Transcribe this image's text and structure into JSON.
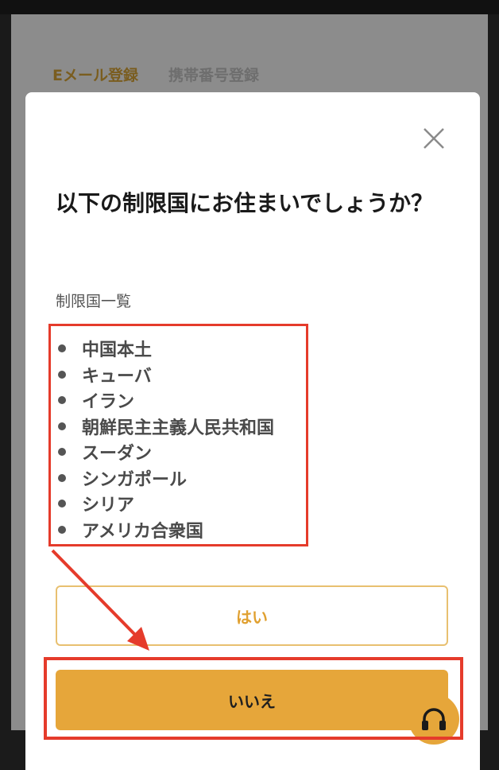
{
  "background": {
    "tabs": [
      {
        "label": "Eメール登録",
        "active": true
      },
      {
        "label": "携帯番号登録",
        "active": false
      }
    ]
  },
  "modal": {
    "title": "以下の制限国にお住まいでしょうか？",
    "subtitle": "制限国一覧",
    "countries": [
      "中国本土",
      "キューバ",
      "イラン",
      "朝鮮民主主義人民共和国",
      "スーダン",
      "シンガポール",
      "シリア",
      "アメリカ合衆国"
    ],
    "yes_label": "はい",
    "no_label": "いいえ"
  },
  "icons": {
    "close": "close-icon",
    "support": "headset-icon"
  },
  "colors": {
    "accent": "#e6a63a",
    "annotation": "#e53b2b"
  }
}
